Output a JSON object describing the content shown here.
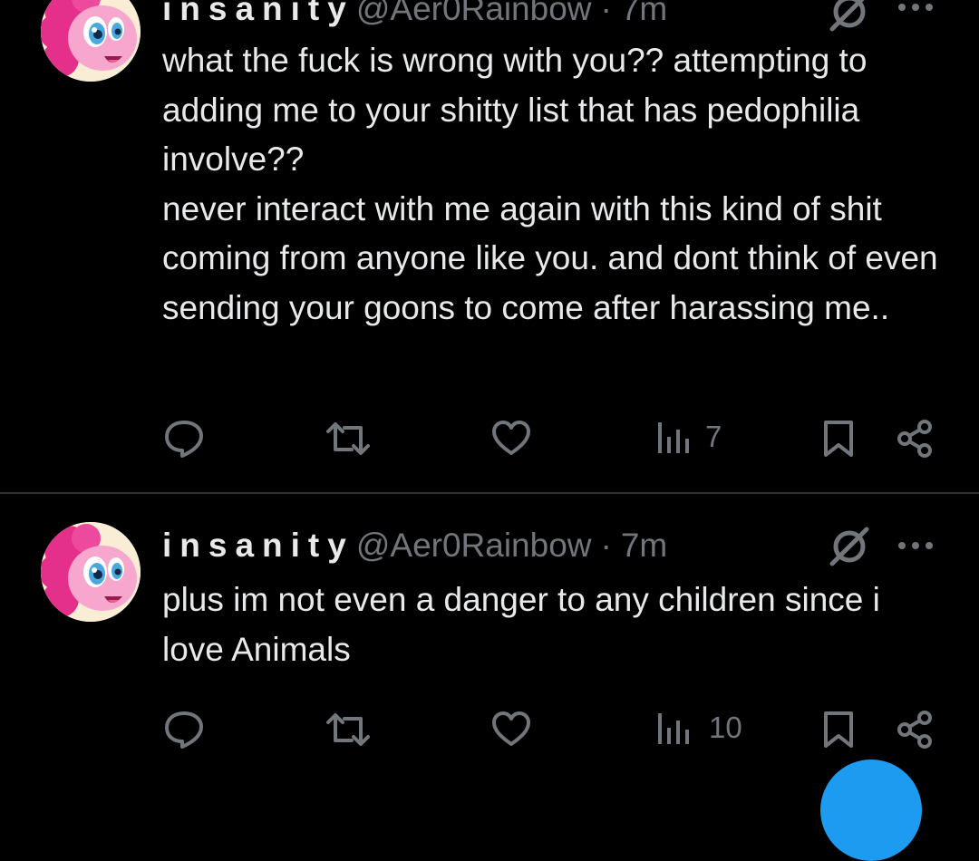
{
  "colors": {
    "background": "#000000",
    "primary_text": "#e7e9ea",
    "secondary_text": "#71767b",
    "divider": "#2f3336",
    "accent": "#1d9bf0"
  },
  "tweets": [
    {
      "display_name": "insanity",
      "handle": "@Aer0Rainbow",
      "separator": "·",
      "time": "7m",
      "lines": [
        "what the fuck is wrong with you?? attempting to adding me to your shitty list that has pedophilia involve??",
        "never interact with me again with this kind of shit coming from anyone like you. and dont think of even sending your goons to come after harassing me.."
      ],
      "views": "7",
      "icons": [
        "grok-icon",
        "more-icon",
        "reply-icon",
        "retweet-icon",
        "like-icon",
        "views-icon",
        "bookmark-icon",
        "share-icon"
      ]
    },
    {
      "display_name": "insanity",
      "handle": "@Aer0Rainbow",
      "separator": "·",
      "time": "7m",
      "lines": [
        "plus im not even a danger to any children since i love Animals"
      ],
      "views": "10",
      "icons": [
        "grok-icon",
        "more-icon",
        "reply-icon",
        "retweet-icon",
        "like-icon",
        "views-icon",
        "bookmark-icon",
        "share-icon"
      ]
    }
  ]
}
